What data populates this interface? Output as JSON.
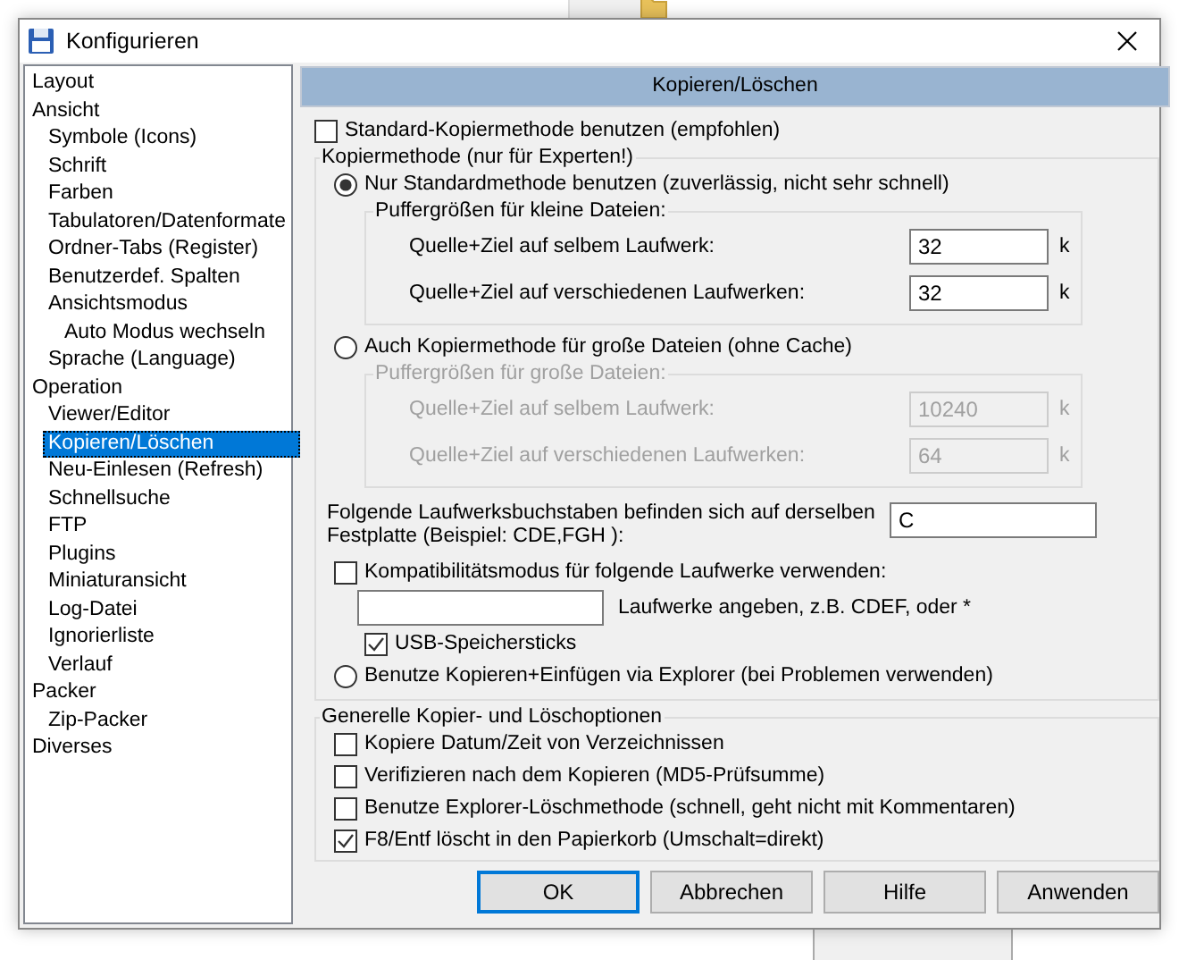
{
  "window": {
    "title": "Konfigurieren"
  },
  "tree": [
    {
      "label": "Layout",
      "selected": false
    },
    {
      "label": "Ansicht",
      "selected": false,
      "children": [
        {
          "label": "Symbole (Icons)",
          "selected": false
        },
        {
          "label": "Schrift",
          "selected": false
        },
        {
          "label": "Farben",
          "selected": false
        },
        {
          "label": "Tabulatoren/Datenformate",
          "selected": false
        },
        {
          "label": "Ordner-Tabs (Register)",
          "selected": false
        },
        {
          "label": "Benutzerdef. Spalten",
          "selected": false
        },
        {
          "label": "Ansichtsmodus",
          "selected": false,
          "children": [
            {
              "label": "Auto Modus wechseln",
              "selected": false
            }
          ]
        },
        {
          "label": "Sprache (Language)",
          "selected": false
        }
      ]
    },
    {
      "label": "Operation",
      "selected": false,
      "children": [
        {
          "label": "Viewer/Editor",
          "selected": false
        },
        {
          "label": "Kopieren/Löschen",
          "selected": true
        },
        {
          "label": "Neu-Einlesen (Refresh)",
          "selected": false
        },
        {
          "label": "Schnellsuche",
          "selected": false
        },
        {
          "label": "FTP",
          "selected": false
        },
        {
          "label": "Plugins",
          "selected": false
        },
        {
          "label": "Miniaturansicht",
          "selected": false
        },
        {
          "label": "Log-Datei",
          "selected": false
        },
        {
          "label": "Ignorierliste",
          "selected": false
        },
        {
          "label": "Verlauf",
          "selected": false
        }
      ]
    },
    {
      "label": "Packer",
      "selected": false,
      "children": [
        {
          "label": "Zip-Packer",
          "selected": false
        }
      ]
    },
    {
      "label": "Diverses",
      "selected": false
    }
  ],
  "panel": {
    "title": "Kopieren/Löschen"
  },
  "standard_method": {
    "label": "Standard-Kopiermethode benutzen (empfohlen)",
    "checked": false
  },
  "copy_method": {
    "title": "Kopiermethode (nur für Experten!)",
    "methods": [
      {
        "label": "Nur Standardmethode benutzen (zuverlässig, nicht sehr schnell)",
        "selected": true,
        "buffers": {
          "title": "Puffergrößen für kleine Dateien:",
          "disabled": false,
          "fields": [
            {
              "label": "Quelle+Ziel auf selbem Laufwerk:",
              "value": "32",
              "unit": "k"
            },
            {
              "label": "Quelle+Ziel auf verschiedenen Laufwerken:",
              "value": "32",
              "unit": "k"
            }
          ]
        }
      },
      {
        "label": "Auch Kopiermethode für große Dateien (ohne Cache)",
        "selected": false,
        "buffers": {
          "title": "Puffergrößen für große Dateien:",
          "disabled": true,
          "fields": [
            {
              "label": "Quelle+Ziel auf selbem Laufwerk:",
              "value": "10240",
              "unit": "k"
            },
            {
              "label": "Quelle+Ziel auf verschiedenen Laufwerken:",
              "value": "64",
              "unit": "k"
            }
          ]
        }
      }
    ],
    "drive_letters": {
      "label": "Folgende Laufwerksbuchstaben befinden sich auf derselben Festplatte (Beispiel: CDE,FGH ):",
      "value": "C"
    },
    "compat": {
      "label": "Kompatibilitätsmodus für folgende Laufwerke verwenden:",
      "checked": false,
      "hint": "Laufwerke angeben, z.B. CDEF, oder *",
      "usb": {
        "label": "USB-Speichersticks",
        "checked": true
      }
    },
    "explorer_method": {
      "label": "Benutze Kopieren+Einfügen via Explorer (bei Problemen verwenden)",
      "selected": false
    }
  },
  "general": {
    "title": "Generelle Kopier- und Löschoptionen",
    "options": [
      {
        "label": "Kopiere Datum/Zeit von Verzeichnissen",
        "checked": false
      },
      {
        "label": "Verifizieren nach dem Kopieren (MD5-Prüfsumme)",
        "checked": false
      },
      {
        "label": "Benutze Explorer-Löschmethode (schnell, geht nicht mit Kommentaren)",
        "checked": false
      },
      {
        "label": "F8/Entf löscht in den Papierkorb (Umschalt=direkt)",
        "checked": true
      }
    ]
  },
  "buttons": [
    {
      "label": "OK",
      "default": true
    },
    {
      "label": "Abbrechen",
      "default": false
    },
    {
      "label": "Hilfe",
      "default": false
    },
    {
      "label": "Anwenden",
      "default": false
    }
  ]
}
